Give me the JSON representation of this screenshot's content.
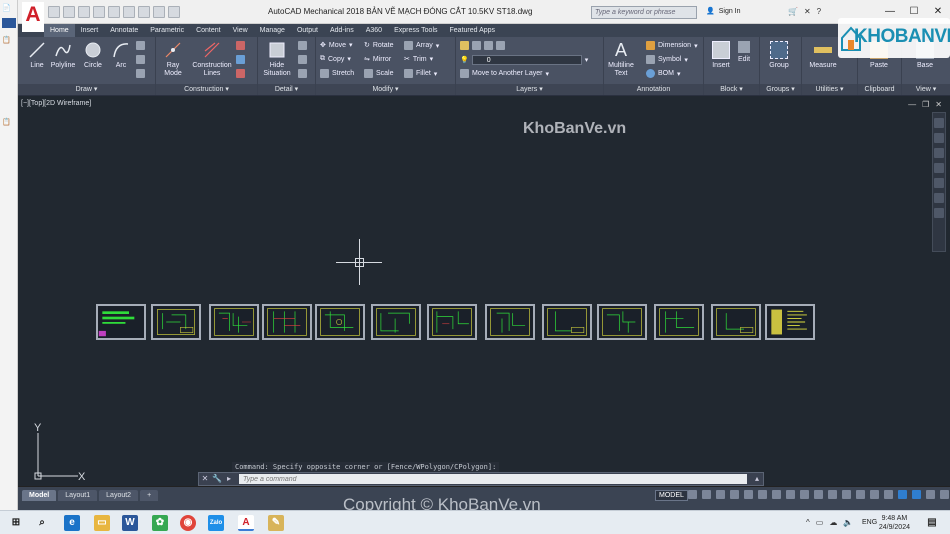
{
  "window": {
    "title": "AutoCAD Mechanical 2018    BẢN VẼ  MẠCH ĐÓNG CẮT 10.5KV ST18.dwg",
    "search_placeholder": "Type a keyword or phrase",
    "signin": "Sign In",
    "app_logo_letter": "A"
  },
  "ribbon_tabs": [
    "Home",
    "Insert",
    "Annotate",
    "Parametric",
    "Content",
    "View",
    "Manage",
    "Output",
    "Add-ins",
    "A360",
    "Express Tools",
    "Featured Apps"
  ],
  "ribbon_groups": {
    "draw": {
      "title": "Draw",
      "buttons": [
        "Line",
        "Polyline",
        "Circle",
        "Arc"
      ]
    },
    "construction": {
      "title": "Construction",
      "buttons": [
        "Ray\nMode",
        "Construction\nLines"
      ]
    },
    "detail": {
      "title": "Detail",
      "buttons": [
        "Hide\nSituation"
      ]
    },
    "modify": {
      "title": "Modify",
      "items": [
        "Move",
        "Rotate",
        "Array",
        "Copy",
        "Mirror",
        "Trim",
        "Stretch",
        "Scale",
        "Fillet"
      ]
    },
    "layers": {
      "title": "Layers",
      "current": "0",
      "move_label": "Move to Another Layer"
    },
    "annotation": {
      "title": "Annotation",
      "buttons": [
        "Multiline\nText"
      ],
      "items": [
        "Dimension",
        "Symbol",
        "BOM"
      ]
    },
    "block": {
      "title": "Block",
      "buttons": [
        "Insert",
        "Edit"
      ]
    },
    "groups": {
      "title": "Groups",
      "buttons": [
        "Group"
      ]
    },
    "utilities": {
      "title": "Utilities",
      "buttons": [
        "Measure"
      ]
    },
    "clipboard": {
      "title": "Clipboard",
      "buttons": [
        "Paste"
      ]
    },
    "view": {
      "title": "View",
      "buttons": [
        "Base"
      ]
    }
  },
  "viewport": {
    "label": "[−][Top][2D Wireframe]",
    "watermark": "KhoBanVe.vn"
  },
  "command": {
    "history": "Command: Specify opposite corner or [Fence/WPolygon/CPolygon]:",
    "placeholder": "Type a command"
  },
  "layout_tabs": [
    "Model",
    "Layout1",
    "Layout2",
    "+"
  ],
  "status": {
    "model": "MODEL"
  },
  "copyright": "Copyright © KhoBanVe.vn",
  "brand": "KHOBANVE",
  "taskbar": {
    "time": "9:48 AM",
    "date": "24/9/2024",
    "lang": "ENG"
  },
  "colors": {
    "ribbon": "#4a5263",
    "viewport": "#212830",
    "accent": "#d0202a"
  }
}
